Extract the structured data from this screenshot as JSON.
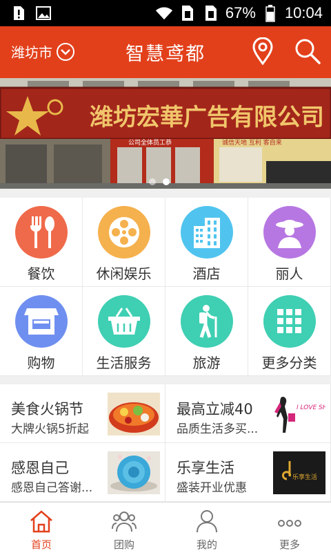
{
  "status_bar": {
    "battery": "67%",
    "time": "10:04"
  },
  "header": {
    "city": "潍坊市",
    "title": "智慧鸢都"
  },
  "banner": {
    "sign_text": "潍坊宏華广告有限公司",
    "sub_sign_left": "公司全体员工恭",
    "sub_sign_right": "诚信天地  互利  客自来",
    "slide_count": 2,
    "active_slide": 2
  },
  "categories": [
    {
      "label": "餐饮",
      "icon": "fork-spoon-icon",
      "color": "#ef6a4a"
    },
    {
      "label": "休闲娱乐",
      "icon": "film-reel-icon",
      "color": "#f5b14d"
    },
    {
      "label": "酒店",
      "icon": "buildings-icon",
      "color": "#50c4ef"
    },
    {
      "label": "丽人",
      "icon": "lady-hat-icon",
      "color": "#b777e2"
    },
    {
      "label": "购物",
      "icon": "storefront-icon",
      "color": "#6f8ff0"
    },
    {
      "label": "生活服务",
      "icon": "basket-icon",
      "color": "#3fcfb3"
    },
    {
      "label": "旅游",
      "icon": "hiker-icon",
      "color": "#3fcfb3"
    },
    {
      "label": "更多分类",
      "icon": "grid-icon",
      "color": "#3fcfb3"
    }
  ],
  "promos": [
    {
      "title": "美食火锅节",
      "subtitle": "大牌火锅5折起",
      "image": "hotpot-image"
    },
    {
      "title": "最高立减40",
      "subtitle": "品质生活多买...",
      "image": "shopping-image",
      "image_text": "I LOVE SHOPPING"
    },
    {
      "title": "感恩自己",
      "subtitle": "感恩自己答谢...",
      "image": "cake-image"
    },
    {
      "title": "乐享生活",
      "subtitle": "盛装开业优惠",
      "image": "logo-image",
      "image_text": "乐享生活"
    }
  ],
  "bottom_nav": [
    {
      "label": "首页",
      "icon": "home-icon",
      "active": true
    },
    {
      "label": "团购",
      "icon": "group-icon",
      "active": false
    },
    {
      "label": "我的",
      "icon": "person-icon",
      "active": false
    },
    {
      "label": "更多",
      "icon": "more-dots-icon",
      "active": false
    }
  ],
  "colors": {
    "brand": "#e2401b",
    "active_tab": "#e2401b"
  }
}
